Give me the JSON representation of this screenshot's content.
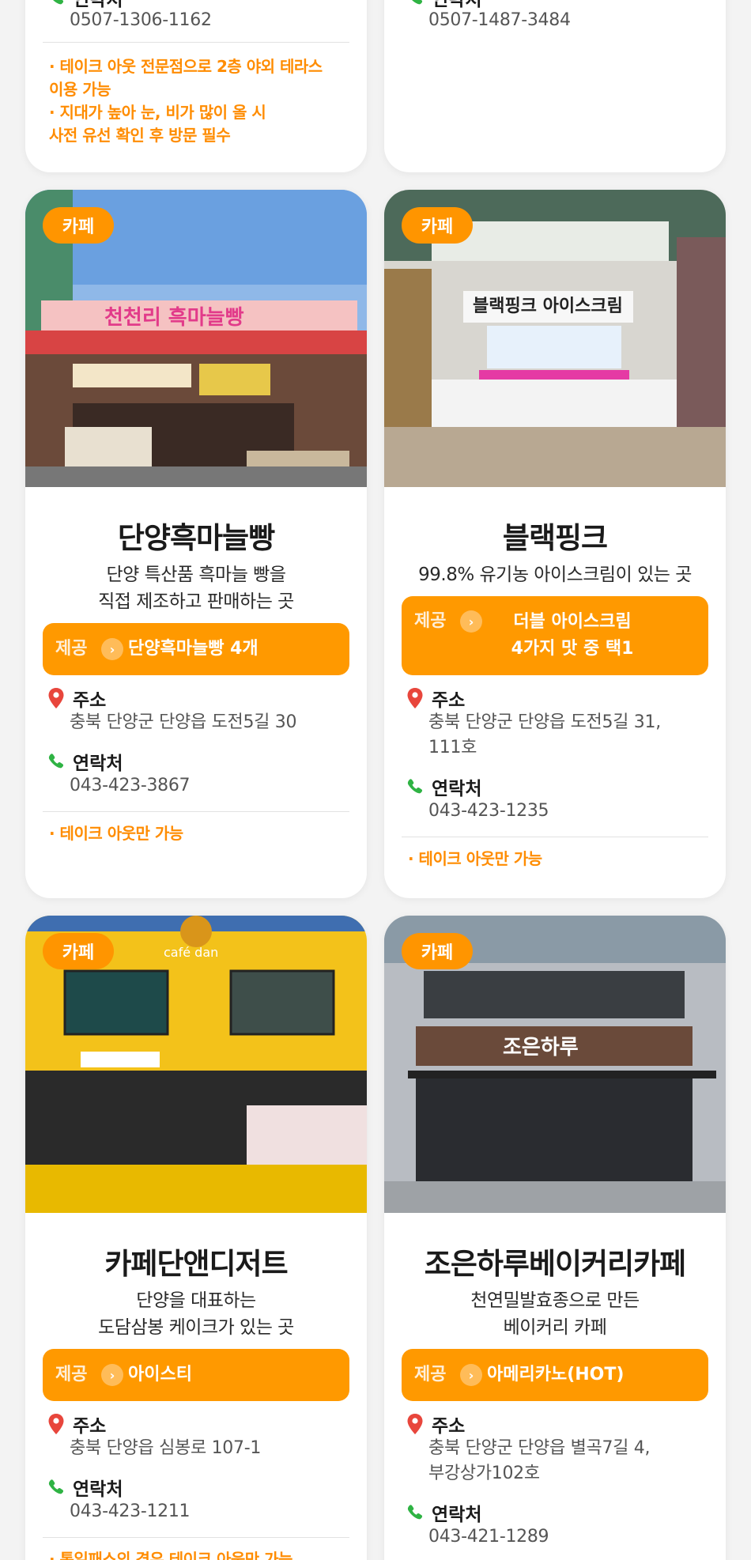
{
  "colors": {
    "accent": "#ff9500",
    "note": "#ff8c00",
    "pin": "#e8463c",
    "phone": "#2fb344"
  },
  "labels": {
    "badge": "카페",
    "offer": "제공",
    "address": "주소",
    "contact": "연락처"
  },
  "top_cards": [
    {
      "phone": "0507-1306-1162",
      "notes": [
        "· 테이크 아웃 전문점으로 2층 야외 테라스\n  이용 가능",
        "· 지대가 높아 눈, 비가 많이 올 시\n  사전 유선 확인 후 방문 필수"
      ]
    },
    {
      "phone": "0507-1487-3484"
    }
  ],
  "cards": [
    {
      "name": "단양흑마늘빵",
      "desc": "단양 특산품 흑마늘 빵을\n직접 제조하고 판매하는 곳",
      "offer": "단양흑마늘빵 4개",
      "address": "충북 단양군 단양읍 도전5길 30",
      "phone": "043-423-3867",
      "note": "· 테이크 아웃만 가능",
      "sign": "천천리 흑마늘빵"
    },
    {
      "name": "블랙핑크",
      "desc": "99.8% 유기농 아이스크림이 있는 곳",
      "offer": "더블 아이스크림\n4가지 맛 중 택1",
      "address": "충북 단양군 단양읍 도전5길 31,\n111호",
      "phone": "043-423-1235",
      "note": "· 테이크 아웃만 가능",
      "sign": "블랙핑크 아이스크림"
    },
    {
      "name": "카페단앤디저트",
      "desc": "단양을 대표하는\n도담삼봉 케이크가 있는 곳",
      "offer": "아이스티",
      "address": "충북 단양읍 심봉로 107-1",
      "phone": "043-423-1211",
      "note": "· 통일패스의 경우 테이크 아웃만 가능",
      "sign": "café dan"
    },
    {
      "name": "조은하루베이커리카페",
      "desc": "천연밀발효종으로 만든\n베이커리 카페",
      "offer": "아메리카노(HOT)",
      "address": "충북 단양군 단양읍 별곡7길 4,\n부강상가102호",
      "phone": "043-421-1289",
      "sign": "조은하루"
    }
  ]
}
